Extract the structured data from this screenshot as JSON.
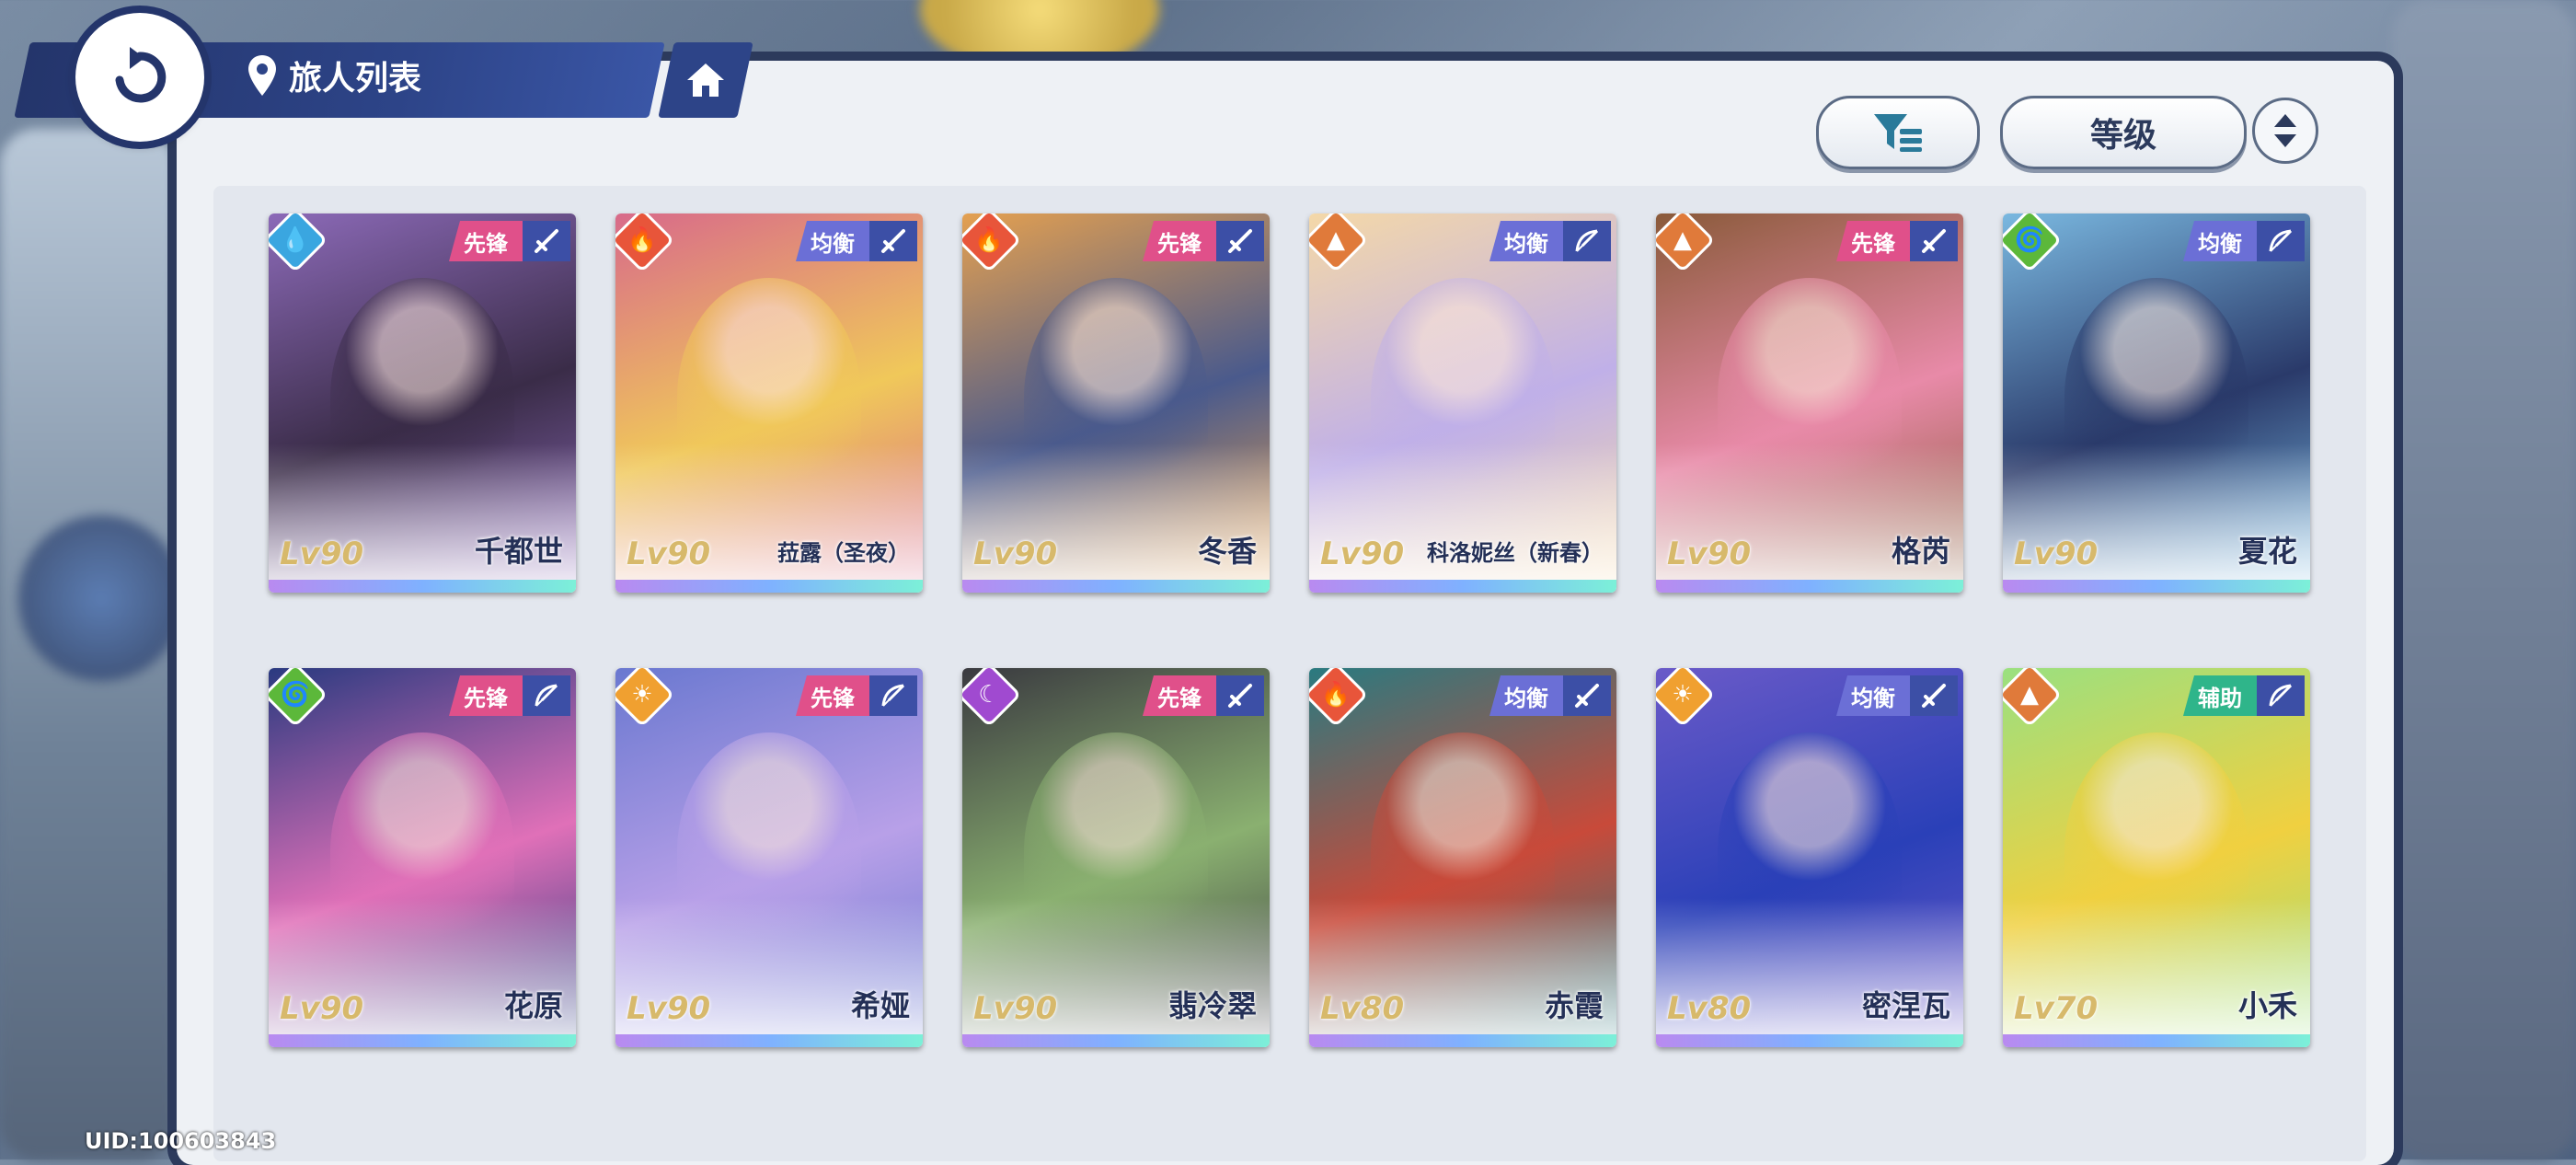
{
  "header": {
    "title": "旅人列表",
    "back_icon": "back-arrow-icon",
    "location_icon": "map-pin-icon",
    "home_icon": "home-icon"
  },
  "toolbar": {
    "filter_icon": "filter-icon",
    "sort_label": "等级",
    "order_icon": "sort-order-icon"
  },
  "footer": {
    "uid": "UID:100603843"
  },
  "colors": {
    "vanguard": "#e0508a",
    "balance": "#6b6fd6",
    "support": "#2fb58a",
    "water": "#3aa6e0",
    "fire": "#e8553a",
    "earth": "#e07a3a",
    "wind": "#5cb83a",
    "light": "#f0a030",
    "dark": "#a04ad0"
  },
  "characters": [
    {
      "name": "千都世",
      "level": "Lv90",
      "role": "先锋",
      "element": "water",
      "weapon": "sword",
      "art": [
        "#3a2c48",
        "#8c6ab8"
      ]
    },
    {
      "name": "菈露（圣夜）",
      "level": "Lv90",
      "role": "均衡",
      "element": "fire",
      "weapon": "sword",
      "art": [
        "#f0c85a",
        "#d86a8a"
      ]
    },
    {
      "name": "冬香",
      "level": "Lv90",
      "role": "先锋",
      "element": "fire",
      "weapon": "sword",
      "art": [
        "#4a5a8c",
        "#e4a050"
      ]
    },
    {
      "name": "科洛妮丝（新春）",
      "level": "Lv90",
      "role": "均衡",
      "element": "earth",
      "weapon": "bow",
      "art": [
        "#c0b0e8",
        "#f4d8a8"
      ]
    },
    {
      "name": "格芮",
      "level": "Lv90",
      "role": "先锋",
      "element": "earth",
      "weapon": "sword",
      "art": [
        "#e88aa8",
        "#8a5a3a"
      ]
    },
    {
      "name": "夏花",
      "level": "Lv90",
      "role": "均衡",
      "element": "wind",
      "weapon": "bow",
      "art": [
        "#2a3a6a",
        "#7ab8e0"
      ]
    },
    {
      "name": "花原",
      "level": "Lv90",
      "role": "先锋",
      "element": "wind",
      "weapon": "bow",
      "art": [
        "#e070b8",
        "#2a3a80"
      ]
    },
    {
      "name": "希娅",
      "level": "Lv90",
      "role": "先锋",
      "element": "light",
      "weapon": "bow",
      "art": [
        "#b8a0e8",
        "#6a78d0"
      ]
    },
    {
      "name": "翡冷翠",
      "level": "Lv90",
      "role": "先锋",
      "element": "dark",
      "weapon": "sword",
      "art": [
        "#8ab070",
        "#3a3a40"
      ]
    },
    {
      "name": "赤霞",
      "level": "Lv80",
      "role": "均衡",
      "element": "fire",
      "weapon": "sword",
      "art": [
        "#c84a3a",
        "#2a7a80"
      ]
    },
    {
      "name": "密涅瓦",
      "level": "Lv80",
      "role": "均衡",
      "element": "light",
      "weapon": "sword",
      "art": [
        "#2a40b8",
        "#6a5ac8"
      ]
    },
    {
      "name": "小禾",
      "level": "Lv70",
      "role": "辅助",
      "element": "earth",
      "weapon": "bow",
      "art": [
        "#f0d040",
        "#9ae080"
      ]
    }
  ]
}
